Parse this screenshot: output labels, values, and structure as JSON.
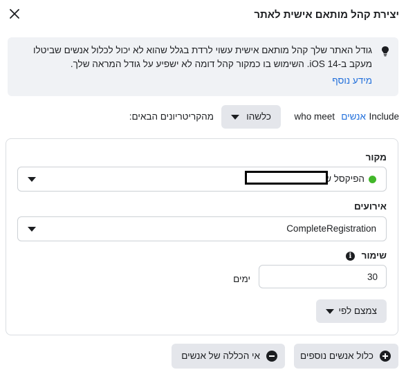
{
  "dialog": {
    "title": "יצירת קהל מותאם אישית לאתר"
  },
  "notice": {
    "text": "גודל האתר שלך קהל מותאם אישית עשוי לרדת בגלל שהוא לא יכול לכלול אנשים שביטלו מעקב ב-iOS 14. השימוש בו כמקור קהל דומה לא ישפיע על גודל המראה שלך.",
    "link": "מידע נוסף",
    "icon": "lightbulb-icon"
  },
  "include": {
    "include_word": "Include",
    "people_link": "אנשים",
    "who_meet": "who meet",
    "match_value": "כלשהו",
    "criteria_text": "מהקריטריונים הבאים:"
  },
  "rule": {
    "source_label": "מקור",
    "source_value": "הפיקסל של",
    "source_status_color": "#42b72a",
    "events_label": "אירועים",
    "events_value": "CompleteRegistration",
    "retention_label": "שימור",
    "retention_value": "30",
    "retention_unit": "ימים",
    "narrow_button": "צמצם לפי"
  },
  "actions": {
    "include_more": "כלול אנשים נוספים",
    "exclude": "אי הכללה של אנשים"
  },
  "colors": {
    "link": "#216fdb",
    "button_bg": "#e4e6eb",
    "notice_bg": "#f0f2f5"
  }
}
